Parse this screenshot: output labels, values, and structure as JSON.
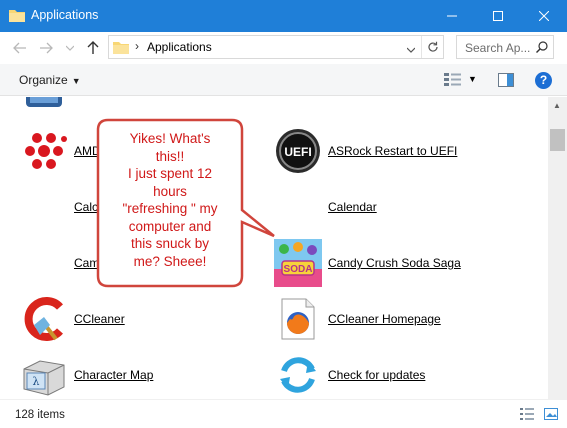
{
  "window": {
    "title": "Applications"
  },
  "address": {
    "path": "Applications",
    "separator": "›"
  },
  "search": {
    "placeholder": "Search Ap..."
  },
  "toolbar": {
    "organize_label": "Organize"
  },
  "items": [
    {
      "label": "AMD",
      "icon": "amd-icon"
    },
    {
      "label": "ASRock Restart to UEFI",
      "icon": "uefi-icon"
    },
    {
      "label": "Calc",
      "icon": "calculator-icon"
    },
    {
      "label": "Calendar",
      "icon": "calendar-icon"
    },
    {
      "label": "Cam",
      "icon": "camera-icon"
    },
    {
      "label": "Candy Crush Soda Saga",
      "icon": "candy-crush-icon"
    },
    {
      "label": "CCleaner",
      "icon": "ccleaner-icon"
    },
    {
      "label": "CCleaner Homepage",
      "icon": "firefox-icon"
    },
    {
      "label": "Character Map",
      "icon": "character-map-icon"
    },
    {
      "label": "Check for updates",
      "icon": "update-icon"
    }
  ],
  "status": {
    "item_count": "128 items"
  },
  "annotation": {
    "lines": [
      "Yikes! What's",
      "this!!",
      "I just spent 12",
      "hours",
      "\"refreshing \" my",
      "computer and",
      "this snuck by",
      "me? Sheee!"
    ]
  },
  "colors": {
    "titlebar": "#1f7fd8",
    "annotation": "#d01818"
  }
}
